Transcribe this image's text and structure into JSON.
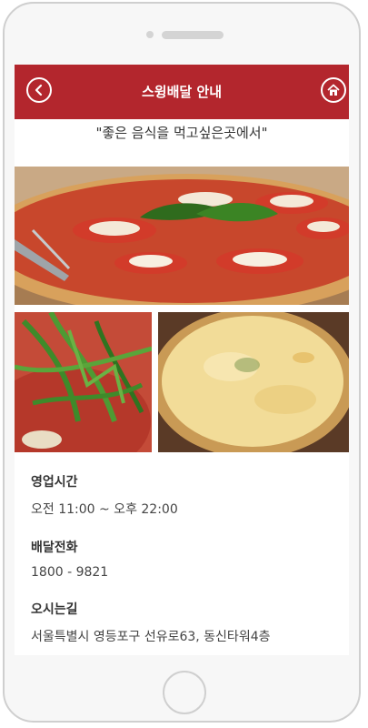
{
  "header": {
    "title": "스윙배달 안내"
  },
  "slogan": "\"좋은 음식을 먹고싶은곳에서\"",
  "info": [
    {
      "label": "영업시간",
      "value": "오전 11:00 ~ 오후 22:00"
    },
    {
      "label": "배달전화",
      "value": "1800 - 9821"
    },
    {
      "label": "오시는길",
      "value": "서울특별시 영등포구 선유로63, 동신타워4층"
    }
  ],
  "colors": {
    "header": "#b3262d"
  },
  "icons": {
    "back": "chevron-left-icon",
    "home": "home-icon"
  },
  "images": {
    "main": "margherita-pizza-photo",
    "left": "arugula-pizza-photo",
    "right": "cheese-pizza-photo"
  }
}
